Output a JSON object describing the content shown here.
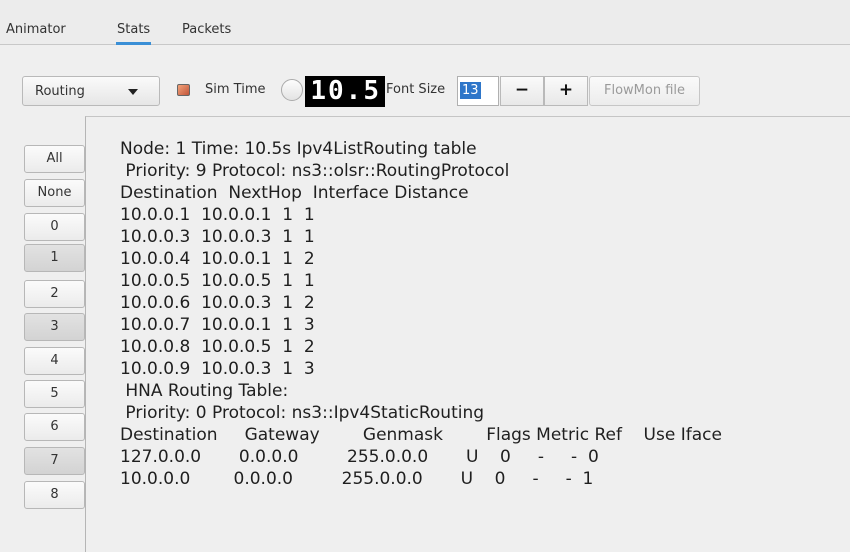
{
  "tabs": [
    "Animator",
    "Stats",
    "Packets"
  ],
  "toolbar": {
    "mode_select": "Routing",
    "sim_time_label": "Sim Time",
    "lcd_value": "10.5",
    "font_size_label": "Font Size",
    "font_size_value": "13",
    "decrement_label": "−",
    "increment_label": "+",
    "flowmon_label": "FlowMon file"
  },
  "nodes": [
    "All",
    "None",
    "0",
    "1",
    "2",
    "3",
    "4",
    "5",
    "6",
    "7",
    "8"
  ],
  "routing_text": [
    "Node: 1 Time: 10.5s Ipv4ListRouting table",
    " Priority: 9 Protocol: ns3::olsr::RoutingProtocol",
    "Destination  NextHop  Interface Distance",
    "10.0.0.1  10.0.0.1  1  1",
    "10.0.0.3  10.0.0.3  1  1",
    "10.0.0.4  10.0.0.1  1  2",
    "10.0.0.5  10.0.0.5  1  1",
    "10.0.0.6  10.0.0.3  1  2",
    "10.0.0.7  10.0.0.1  1  3",
    "10.0.0.8  10.0.0.5  1  2",
    "10.0.0.9  10.0.0.3  1  3",
    " HNA Routing Table:",
    " Priority: 0 Protocol: ns3::Ipv4StaticRouting",
    "Destination     Gateway        Genmask        Flags Metric Ref    Use Iface",
    "127.0.0.0       0.0.0.0         255.0.0.0       U    0     -     -  0",
    "10.0.0.0        0.0.0.0         255.0.0.0       U    0     -     -  1"
  ]
}
